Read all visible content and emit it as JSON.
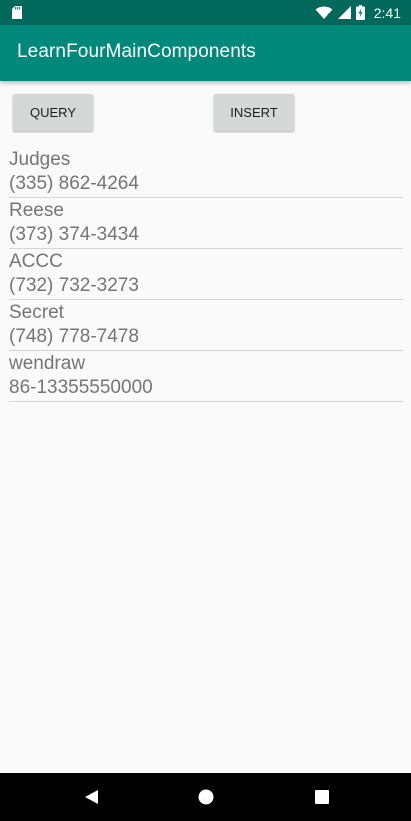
{
  "status_bar": {
    "time": "2:41",
    "icons": [
      "sd-card-icon",
      "wifi-icon",
      "signal-icon",
      "battery-icon"
    ]
  },
  "app_bar": {
    "title": "LearnFourMainComponents",
    "color": "#00897b",
    "status_color": "#00695c"
  },
  "buttons": {
    "query_label": "QUERY",
    "insert_label": "INSERT"
  },
  "contacts": [
    {
      "name": "Judges",
      "phone": "(335) 862-4264"
    },
    {
      "name": "Reese",
      "phone": "(373) 374-3434"
    },
    {
      "name": "ACCC",
      "phone": "(732) 732-3273"
    },
    {
      "name": "Secret",
      "phone": "(748) 778-7478"
    },
    {
      "name": "wendraw",
      "phone": "86-13355550000"
    }
  ],
  "nav_bar": {
    "icons": [
      "back-icon",
      "home-icon",
      "recent-apps-icon"
    ]
  }
}
